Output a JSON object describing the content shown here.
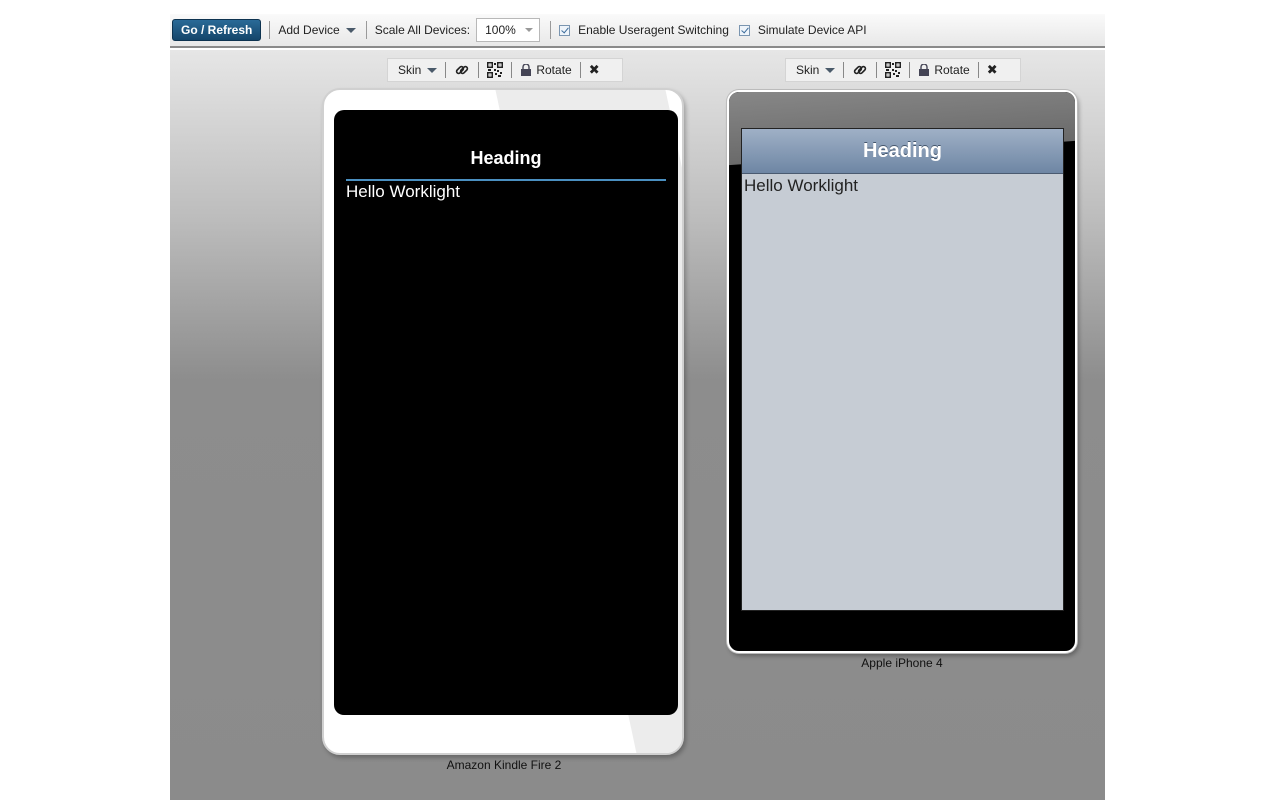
{
  "toolbar": {
    "go_refresh": "Go / Refresh",
    "add_device": "Add Device",
    "scale_label": "Scale All Devices:",
    "scale_value": "100%",
    "useragent_label": "Enable Useragent Switching",
    "useragent_checked": true,
    "device_api_label": "Simulate Device API",
    "device_api_checked": true
  },
  "devices": [
    {
      "name": "Amazon Kindle Fire 2",
      "skin_label": "Skin",
      "rotate_label": "Rotate",
      "app": {
        "heading": "Heading",
        "content": "Hello Worklight"
      }
    },
    {
      "name": "Apple iPhone 4",
      "skin_label": "Skin",
      "rotate_label": "Rotate",
      "app": {
        "heading": "Heading",
        "content": "Hello Worklight"
      }
    }
  ],
  "icons": {
    "link": "link-icon",
    "qr": "qr-code-icon",
    "lock": "lock-icon",
    "close": "close-icon"
  }
}
